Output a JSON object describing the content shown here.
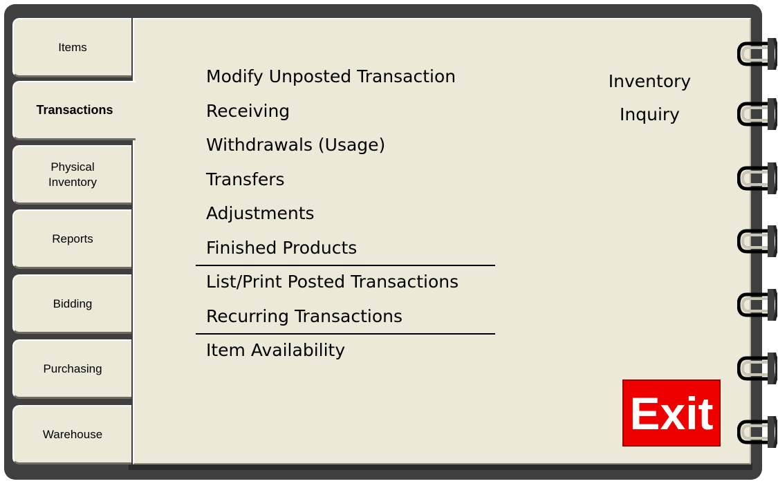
{
  "tabs": [
    {
      "label": "Items",
      "active": false
    },
    {
      "label": "Transactions",
      "active": true
    },
    {
      "label": "Physical\nInventory",
      "active": false
    },
    {
      "label": "Reports",
      "active": false
    },
    {
      "label": "Bidding",
      "active": false
    },
    {
      "label": "Purchasing",
      "active": false
    },
    {
      "label": "Warehouse",
      "active": false
    }
  ],
  "menu": {
    "group1": [
      "Modify Unposted Transaction",
      "Receiving",
      "Withdrawals (Usage)",
      "Transfers",
      "Adjustments",
      "Finished Products"
    ],
    "group2": [
      "List/Print Posted Transactions",
      "Recurring Transactions"
    ],
    "group3": [
      "Item Availability"
    ]
  },
  "inquiry": {
    "line1": "Inventory",
    "line2": "Inquiry"
  },
  "exit": {
    "label": "Exit",
    "color": "#ee0000"
  },
  "colors": {
    "page": "#ece9d8",
    "binder": "#3f3f3f"
  }
}
